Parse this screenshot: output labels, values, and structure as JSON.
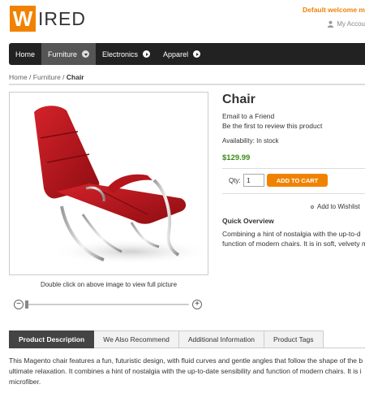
{
  "header": {
    "logo_letter": "W",
    "logo_rest": "IRED",
    "welcome": "Default welcome m",
    "my_account": "My Accou"
  },
  "nav": {
    "items": [
      {
        "label": "Home"
      },
      {
        "label": "Furniture"
      },
      {
        "label": "Electronics"
      },
      {
        "label": "Apparel"
      }
    ]
  },
  "breadcrumb": {
    "home": "Home",
    "sep1": " / ",
    "category": "Furniture",
    "sep2": " / ",
    "current": "Chair"
  },
  "product": {
    "title": "Chair",
    "email_friend": "Email to a Friend",
    "review": "Be the first to review this product",
    "availability": "Availability: In stock",
    "price": "$129.99",
    "qty_label": "Qty:",
    "qty_value": "1",
    "add_to_cart": "ADD TO CART",
    "wishlist": "Add to Wishlist",
    "overview_title": "Quick Overview",
    "overview_lines": [
      "Combining a hint of nostalgia with the up-to-d",
      "function of modern chairs. It is in soft, velvety m"
    ]
  },
  "image": {
    "caption": "Double click on above image to view full picture",
    "zoom_level": 0
  },
  "tabs": [
    {
      "label": "Product Description"
    },
    {
      "label": "We Also Recommend"
    },
    {
      "label": "Additional Information"
    },
    {
      "label": "Product Tags"
    }
  ],
  "description": {
    "lines": [
      "This Magento chair features a fun, futuristic design, with fluid curves and gentle angles that follow the shape of the b",
      "ultimate relaxation. It combines a hint of nostalgia with the up-to-date sensibility and function of modern chairs. It is i",
      "microfiber."
    ]
  },
  "colors": {
    "accent": "#f18200",
    "nav_bg": "#222222",
    "price": "#3a8a1a"
  }
}
